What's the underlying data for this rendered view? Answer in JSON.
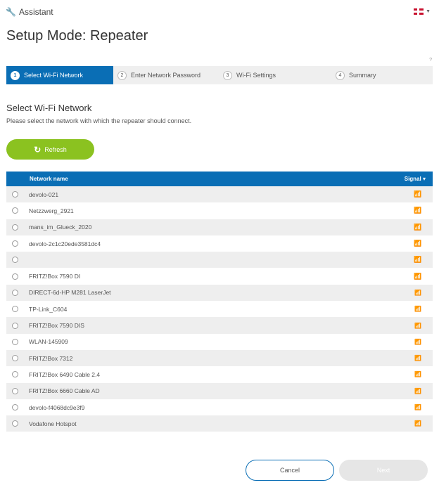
{
  "header": {
    "tool_icon": "wrench-icon",
    "app_label": "Assistant",
    "language_flag": "uk-flag-icon"
  },
  "page": {
    "title": "Setup Mode: Repeater",
    "help": "?"
  },
  "steps": [
    {
      "num": "1",
      "label": "Select Wi-Fi Network"
    },
    {
      "num": "2",
      "label": "Enter Network Password"
    },
    {
      "num": "3",
      "label": "Wi-Fi Settings"
    },
    {
      "num": "4",
      "label": "Summary"
    }
  ],
  "section": {
    "title": "Select Wi-Fi Network",
    "description": "Please select the network with which the repeater should connect."
  },
  "refresh_button": {
    "label": "Refresh",
    "icon": "refresh-icon"
  },
  "table": {
    "col_name": "Network name",
    "col_signal": "Signal",
    "rows": [
      {
        "name": "devolo-021",
        "signal": "strong"
      },
      {
        "name": "Netzzwerg_2921",
        "signal": "strong"
      },
      {
        "name": "mans_im_Glueck_2020",
        "signal": "strong"
      },
      {
        "name": "devolo-2c1c20ede3581dc4",
        "signal": "strong"
      },
      {
        "name": "",
        "signal": "strong"
      },
      {
        "name": "FRITZ!Box 7590 DI",
        "signal": "medium"
      },
      {
        "name": "DIRECT-6d-HP M281 LaserJet",
        "signal": "weak"
      },
      {
        "name": "TP-Link_C604",
        "signal": "weak"
      },
      {
        "name": "FRITZ!Box 7590 DIS",
        "signal": "weak"
      },
      {
        "name": "WLAN-145909",
        "signal": "weak"
      },
      {
        "name": "FRITZ!Box 7312",
        "signal": "weak"
      },
      {
        "name": "FRITZ!Box 6490 Cable 2.4",
        "signal": "weak"
      },
      {
        "name": "FRITZ!Box 6660 Cable AD",
        "signal": "weak"
      },
      {
        "name": "devolo-f4068dc9e3f9",
        "signal": "weak"
      },
      {
        "name": "Vodafone Hotspot",
        "signal": "weak"
      }
    ]
  },
  "footer": {
    "cancel_label": "Cancel",
    "next_label": "Next"
  },
  "colors": {
    "primary": "#0a6eb5",
    "accent_green": "#8bc220"
  }
}
